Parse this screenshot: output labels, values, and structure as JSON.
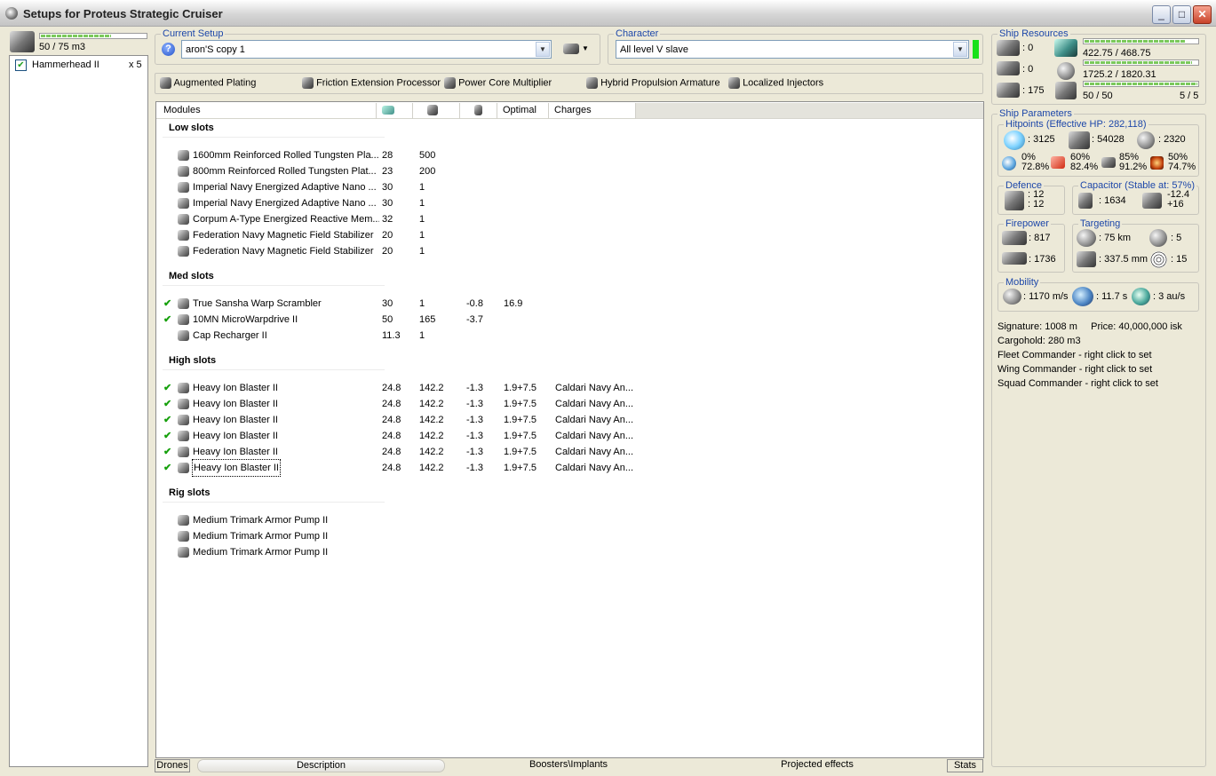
{
  "window": {
    "title": "Setups for Proteus Strategic Cruiser"
  },
  "drone_bay": {
    "capacity": "50 / 75 m3",
    "capacity_fill": 0.67,
    "items": [
      {
        "name": "Hammerhead II",
        "qty": "x 5",
        "checked": true
      }
    ]
  },
  "current_setup": {
    "label": "Current Setup",
    "value": "aron'S copy 1"
  },
  "character": {
    "label": "Character",
    "value": "All level V slave"
  },
  "subsystems": [
    "Augmented Plating",
    "Friction Extension Processor",
    "Power Core Multiplier",
    "Hybrid Propulsion Armature",
    "Localized Injectors"
  ],
  "columns": {
    "modules": "Modules",
    "optimal": "Optimal",
    "charges": "Charges"
  },
  "sections": {
    "low": {
      "title": "Low slots",
      "rows": [
        {
          "name": "1600mm Reinforced Rolled Tungsten Pla...",
          "c1": "28",
          "c2": "500",
          "c3": "",
          "c4": "",
          "c5": "",
          "active": false
        },
        {
          "name": "800mm Reinforced Rolled Tungsten Plat...",
          "c1": "23",
          "c2": "200",
          "c3": "",
          "c4": "",
          "c5": "",
          "active": false
        },
        {
          "name": "Imperial Navy Energized Adaptive Nano ...",
          "c1": "30",
          "c2": "1",
          "c3": "",
          "c4": "",
          "c5": "",
          "active": false
        },
        {
          "name": "Imperial Navy Energized Adaptive Nano ...",
          "c1": "30",
          "c2": "1",
          "c3": "",
          "c4": "",
          "c5": "",
          "active": false
        },
        {
          "name": "Corpum A-Type Energized Reactive Mem...",
          "c1": "32",
          "c2": "1",
          "c3": "",
          "c4": "",
          "c5": "",
          "active": false
        },
        {
          "name": "Federation Navy Magnetic Field Stabilizer",
          "c1": "20",
          "c2": "1",
          "c3": "",
          "c4": "",
          "c5": "",
          "active": false
        },
        {
          "name": "Federation Navy Magnetic Field Stabilizer",
          "c1": "20",
          "c2": "1",
          "c3": "",
          "c4": "",
          "c5": "",
          "active": false
        }
      ]
    },
    "med": {
      "title": "Med slots",
      "rows": [
        {
          "name": "True Sansha Warp Scrambler",
          "c1": "30",
          "c2": "1",
          "c3": "-0.8",
          "c4": "16.9",
          "c5": "",
          "active": true
        },
        {
          "name": "10MN MicroWarpdrive II",
          "c1": "50",
          "c2": "165",
          "c3": "-3.7",
          "c4": "",
          "c5": "",
          "active": true
        },
        {
          "name": "Cap Recharger II",
          "c1": "11.3",
          "c2": "1",
          "c3": "",
          "c4": "",
          "c5": "",
          "active": false
        }
      ]
    },
    "high": {
      "title": "High slots",
      "rows": [
        {
          "name": "Heavy Ion Blaster II",
          "c1": "24.8",
          "c2": "142.2",
          "c3": "-1.3",
          "c4": "1.9+7.5",
          "c5": "Caldari Navy An...",
          "active": true
        },
        {
          "name": "Heavy Ion Blaster II",
          "c1": "24.8",
          "c2": "142.2",
          "c3": "-1.3",
          "c4": "1.9+7.5",
          "c5": "Caldari Navy An...",
          "active": true
        },
        {
          "name": "Heavy Ion Blaster II",
          "c1": "24.8",
          "c2": "142.2",
          "c3": "-1.3",
          "c4": "1.9+7.5",
          "c5": "Caldari Navy An...",
          "active": true
        },
        {
          "name": "Heavy Ion Blaster II",
          "c1": "24.8",
          "c2": "142.2",
          "c3": "-1.3",
          "c4": "1.9+7.5",
          "c5": "Caldari Navy An...",
          "active": true
        },
        {
          "name": "Heavy Ion Blaster II",
          "c1": "24.8",
          "c2": "142.2",
          "c3": "-1.3",
          "c4": "1.9+7.5",
          "c5": "Caldari Navy An...",
          "active": true
        },
        {
          "name": "Heavy Ion Blaster II",
          "c1": "24.8",
          "c2": "142.2",
          "c3": "-1.3",
          "c4": "1.9+7.5",
          "c5": "Caldari Navy An...",
          "active": true
        }
      ]
    },
    "rig": {
      "title": "Rig slots",
      "rows": [
        {
          "name": "Medium Trimark Armor Pump II",
          "c1": "",
          "c2": "",
          "c3": "",
          "c4": "",
          "c5": "",
          "active": false
        },
        {
          "name": "Medium Trimark Armor Pump II",
          "c1": "",
          "c2": "",
          "c3": "",
          "c4": "",
          "c5": "",
          "active": false
        },
        {
          "name": "Medium Trimark Armor Pump II",
          "c1": "",
          "c2": "",
          "c3": "",
          "c4": "",
          "c5": "",
          "active": false
        }
      ]
    }
  },
  "resources": {
    "title": "Ship Resources",
    "hardpoints": [
      ": 0",
      ": 0",
      ": 175"
    ],
    "cpu": "422.75 / 468.75",
    "cpu_fill": 0.9,
    "power": "1725.2 / 1820.31",
    "power_fill": 0.95,
    "drone": "50 / 50",
    "drone_fill": 1.0,
    "drones_active": "5 / 5"
  },
  "parameters": {
    "title": "Ship Parameters",
    "hitpoints_title": "Hitpoints (Effective HP: 282,118)",
    "shield_hp": ": 3125",
    "armor_hp": ": 54028",
    "structure_hp": ": 2320",
    "resists": [
      [
        "0%",
        "72.8%"
      ],
      [
        "60%",
        "82.4%"
      ],
      [
        "85%",
        "91.2%"
      ],
      [
        "50%",
        "74.7%"
      ]
    ],
    "defence_title": "Defence",
    "defence": [
      ": 12",
      ": 12"
    ],
    "capacitor_title": "Capacitor (Stable at: 57%)",
    "capacitor": ": 1634",
    "cap_rates": [
      "-12.4",
      "+16"
    ],
    "firepower_title": "Firepower",
    "firepower": [
      ": 817",
      ": 1736"
    ],
    "targeting_title": "Targeting",
    "targeting": [
      ": 75 km",
      ": 5",
      ": 337.5 mm",
      ": 15"
    ],
    "mobility_title": "Mobility",
    "mobility": [
      ": 1170 m/s",
      ": 11.7 s",
      ": 3 au/s"
    ],
    "info": [
      "Signature: 1008 m     Price: 40,000,000 isk",
      "Cargohold: 280 m3",
      "Fleet Commander - right click to set",
      "Wing Commander - right click to set",
      "Squad Commander - right click to set"
    ]
  },
  "bottom_tabs": {
    "drones": "Drones",
    "description": "Description",
    "boosters": "Boosters\\Implants",
    "projected": "Projected effects",
    "stats": "Stats"
  }
}
